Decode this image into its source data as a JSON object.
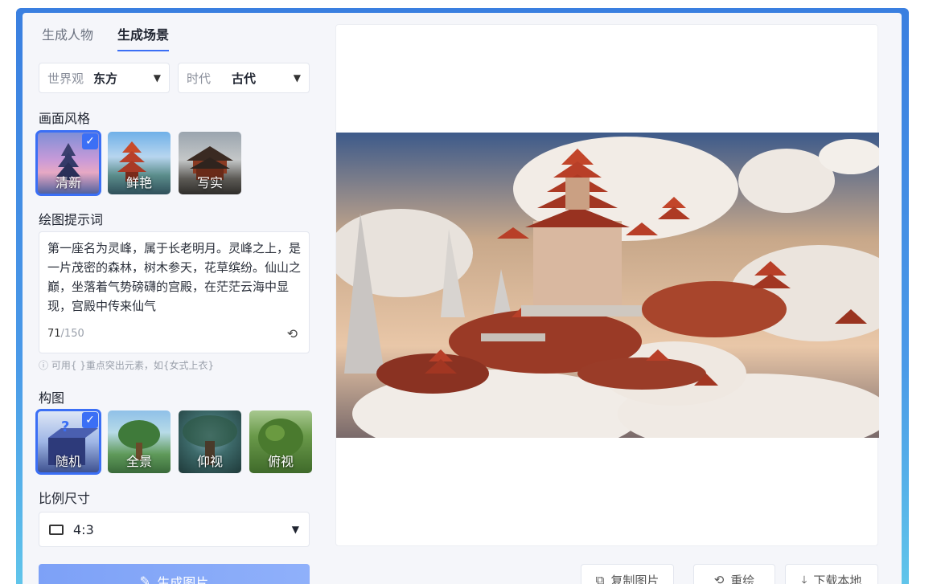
{
  "tabs": [
    {
      "label": "生成人物",
      "active": false
    },
    {
      "label": "生成场景",
      "active": true
    }
  ],
  "worldview": {
    "label": "世界观",
    "value": "东方"
  },
  "era": {
    "label": "时代",
    "value": "古代"
  },
  "style": {
    "title": "画面风格",
    "items": [
      {
        "label": "清新",
        "selected": true
      },
      {
        "label": "鲜艳",
        "selected": false
      },
      {
        "label": "写实",
        "selected": false
      }
    ]
  },
  "prompt": {
    "title": "绘图提示词",
    "text": "第一座名为灵峰，属于长老明月。灵峰之上，是一片茂密的森林，树木参天，花草缤纷。仙山之巅，坐落着气势磅礴的宫殿，在茫茫云海中显现，宫殿中传来仙气",
    "count": "71",
    "max": "/150",
    "hint": "ⓘ 可用{ }重点突出元素，如{女式上衣}"
  },
  "composition": {
    "title": "构图",
    "items": [
      {
        "label": "随机",
        "selected": true
      },
      {
        "label": "全景",
        "selected": false
      },
      {
        "label": "仰视",
        "selected": false
      },
      {
        "label": "俯视",
        "selected": false
      }
    ]
  },
  "ratio": {
    "title": "比例尺寸",
    "value": "4:3"
  },
  "generate_label": "生成图片",
  "actions": {
    "copy": "复制图片",
    "redraw": "重绘",
    "download": "下载本地"
  },
  "colors": {
    "accent": "#3b6ff5",
    "frame": "#3a7fe0"
  }
}
